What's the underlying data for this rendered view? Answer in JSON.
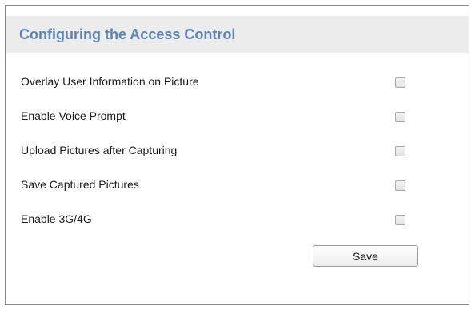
{
  "header": {
    "title": "Configuring the Access Control"
  },
  "options": [
    {
      "label": "Overlay User Information on Picture",
      "checked": false
    },
    {
      "label": "Enable Voice Prompt",
      "checked": false
    },
    {
      "label": "Upload Pictures after Capturing",
      "checked": false
    },
    {
      "label": "Save Captured Pictures",
      "checked": false
    },
    {
      "label": "Enable 3G/4G",
      "checked": false
    }
  ],
  "actions": {
    "save_label": "Save"
  }
}
